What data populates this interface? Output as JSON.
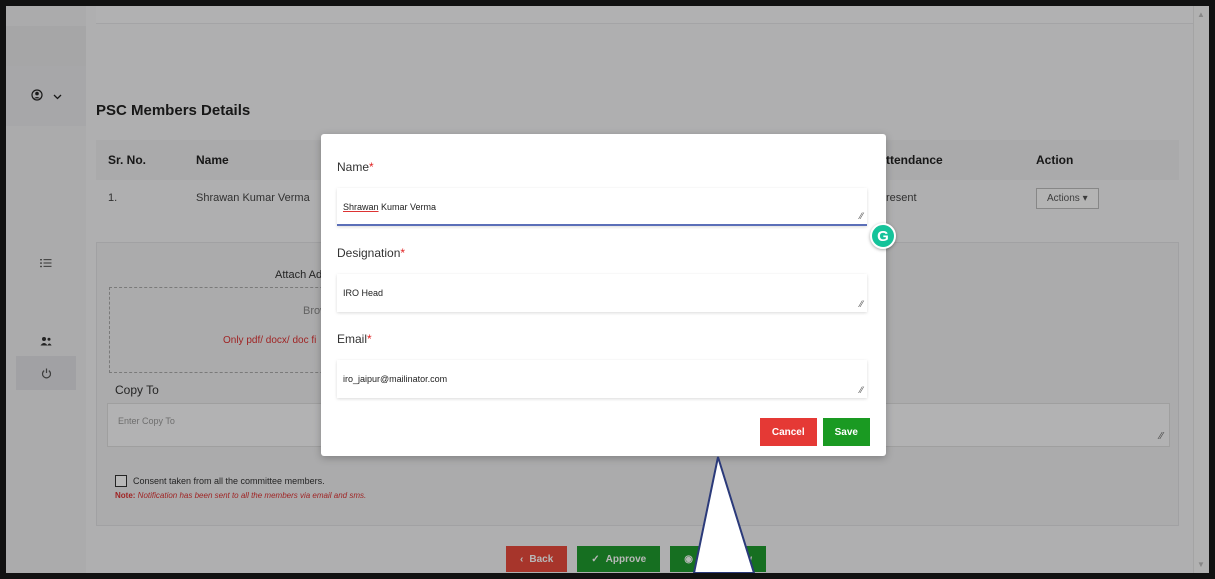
{
  "sidebar": {
    "user_chevron": "⌄",
    "icons": [
      "list-icon",
      "users-icon",
      "power-icon"
    ]
  },
  "section": {
    "title": "PSC Members Details"
  },
  "table": {
    "headers": {
      "sr": "Sr. No.",
      "name": "Name",
      "attendance": "ttendance",
      "action": "Action"
    },
    "rows": [
      {
        "sr": "1.",
        "name": "Shrawan Kumar Verma",
        "attendance": "resent",
        "action": "Actions ▾"
      }
    ]
  },
  "card": {
    "attach_label": "Attach Ad",
    "browse": "Brow",
    "only_pdf": "Only pdf/ docx/ doc fi",
    "copy_to_label": "Copy To",
    "copy_to_placeholder": "Enter Copy To",
    "consent": "Consent taken from all the committee members.",
    "note_prefix": "Note:",
    "note_text": " Notification has been sent to all the members via email and sms."
  },
  "bottom_buttons": {
    "back": "Back",
    "approve": "Approve",
    "preview": "review"
  },
  "modal": {
    "name_label": "Name",
    "name_value_first": "Shrawan",
    "name_value_rest": " Kumar Verma",
    "designation_label": "Designation",
    "designation_value": "IRO Head",
    "email_label": "Email",
    "email_value": "iro_jaipur@mailinator.com",
    "required_mark": "*",
    "cancel": "Cancel",
    "save": "Save",
    "grammarly": "G"
  },
  "colors": {
    "accent_red": "#e53935",
    "accent_green": "#1a9a22",
    "grammarly": "#15c39a",
    "callout_stroke": "#2b3a7a"
  }
}
